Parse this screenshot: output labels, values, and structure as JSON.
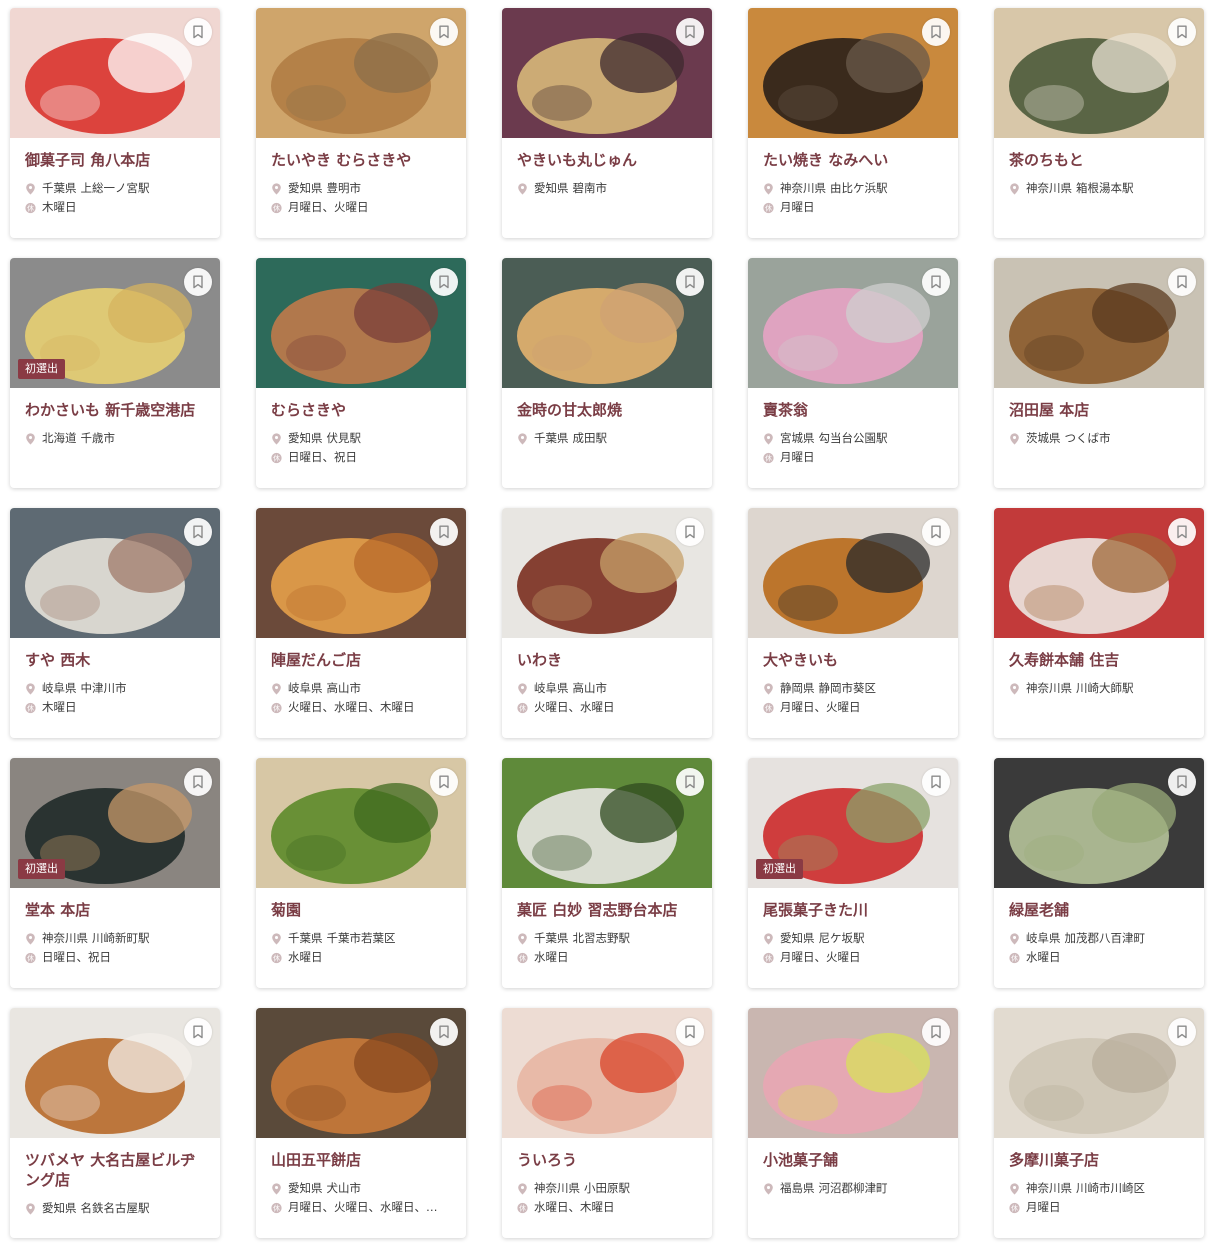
{
  "badge_label": "初選出",
  "colors": {
    "accent": "#7a3d45",
    "badge": "#8a3a44",
    "icon": "#c9b4b6"
  },
  "icons": {
    "location": "location-pin-icon",
    "closed": "closed-day-icon",
    "bookmark": "bookmark-icon"
  },
  "shops": [
    {
      "name": "御菓子司 角八本店",
      "pref": "千葉県",
      "area": "上総一ノ宮駅",
      "closed": "木曜日",
      "badge": false
    },
    {
      "name": "たいやき むらさきや",
      "pref": "愛知県",
      "area": "豊明市",
      "closed": "月曜日、火曜日",
      "badge": false
    },
    {
      "name": "やきいも丸じゅん",
      "pref": "愛知県",
      "area": "碧南市",
      "closed": "",
      "badge": false
    },
    {
      "name": "たい焼き なみへい",
      "pref": "神奈川県",
      "area": "由比ケ浜駅",
      "closed": "月曜日",
      "badge": false
    },
    {
      "name": "茶のちもと",
      "pref": "神奈川県",
      "area": "箱根湯本駅",
      "closed": "",
      "badge": false
    },
    {
      "name": "わかさいも 新千歳空港店",
      "pref": "北海道",
      "area": "千歳市",
      "closed": "",
      "badge": true
    },
    {
      "name": "むらさきや",
      "pref": "愛知県",
      "area": "伏見駅",
      "closed": "日曜日、祝日",
      "badge": false
    },
    {
      "name": "金時の甘太郎焼",
      "pref": "千葉県",
      "area": "成田駅",
      "closed": "",
      "badge": false
    },
    {
      "name": "賣茶翁",
      "pref": "宮城県",
      "area": "勾当台公園駅",
      "closed": "月曜日",
      "badge": false
    },
    {
      "name": "沼田屋 本店",
      "pref": "茨城県",
      "area": "つくば市",
      "closed": "",
      "badge": false
    },
    {
      "name": "すや 西木",
      "pref": "岐阜県",
      "area": "中津川市",
      "closed": "木曜日",
      "badge": false
    },
    {
      "name": "陣屋だんご店",
      "pref": "岐阜県",
      "area": "高山市",
      "closed": "火曜日、水曜日、木曜日",
      "badge": false
    },
    {
      "name": "いわき",
      "pref": "岐阜県",
      "area": "高山市",
      "closed": "火曜日、水曜日",
      "badge": false
    },
    {
      "name": "大やきいも",
      "pref": "静岡県",
      "area": "静岡市葵区",
      "closed": "月曜日、火曜日",
      "badge": false
    },
    {
      "name": "久寿餅本舗 住吉",
      "pref": "神奈川県",
      "area": "川崎大師駅",
      "closed": "",
      "badge": false
    },
    {
      "name": "堂本 本店",
      "pref": "神奈川県",
      "area": "川崎新町駅",
      "closed": "日曜日、祝日",
      "badge": true
    },
    {
      "name": "菊園",
      "pref": "千葉県",
      "area": "千葉市若葉区",
      "closed": "水曜日",
      "badge": false
    },
    {
      "name": "菓匠 白妙 習志野台本店",
      "pref": "千葉県",
      "area": "北習志野駅",
      "closed": "水曜日",
      "badge": false
    },
    {
      "name": "尾張菓子きた川",
      "pref": "愛知県",
      "area": "尼ケ坂駅",
      "closed": "月曜日、火曜日",
      "badge": true
    },
    {
      "name": "緑屋老舗",
      "pref": "岐阜県",
      "area": "加茂郡八百津町",
      "closed": "水曜日",
      "badge": false
    },
    {
      "name": "ツバメヤ 大名古屋ビルヂング店",
      "pref": "愛知県",
      "area": "名鉄名古屋駅",
      "closed": "",
      "badge": false
    },
    {
      "name": "山田五平餅店",
      "pref": "愛知県",
      "area": "犬山市",
      "closed": "月曜日、火曜日、水曜日、…",
      "badge": false
    },
    {
      "name": "ういろう",
      "pref": "神奈川県",
      "area": "小田原駅",
      "closed": "水曜日、木曜日",
      "badge": false
    },
    {
      "name": "小池菓子舗",
      "pref": "福島県",
      "area": "河沼郡柳津町",
      "closed": "",
      "badge": false
    },
    {
      "name": "多摩川菓子店",
      "pref": "神奈川県",
      "area": "川崎市川崎区",
      "closed": "月曜日",
      "badge": false
    }
  ]
}
